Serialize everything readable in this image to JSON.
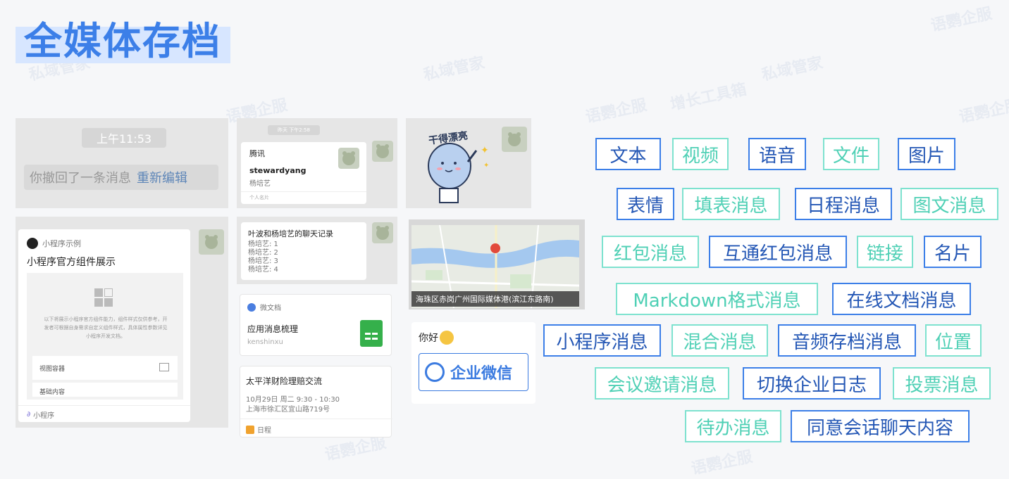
{
  "title": "全媒体存档",
  "watermarks": [
    "语鹦企服",
    "增长工具箱",
    "私域管家"
  ],
  "recall": {
    "time": "上午11:53",
    "text": "你撤回了一条消息",
    "link": "重新编辑"
  },
  "business_card": {
    "time": "昨天 下午2:58",
    "company": "腾讯",
    "name": "stewardyang",
    "sub": "杨培艺",
    "footer": "个人名片"
  },
  "sticker": {
    "caption": "干得漂亮"
  },
  "miniprogram": {
    "app": "小程序示例",
    "title": "小程序官方组件展示",
    "desc": "以下将展示小程序官方组件能力，组件样式仅供参考，开发者可根据自身需求自定义组件样式，具体属性参数详见小程序开发文档。",
    "menu1": "视图容器",
    "menu2": "基础内容",
    "footer": "小程序"
  },
  "chat_record": {
    "title": "叶波和杨培艺的聊天记录",
    "lines": [
      "杨培艺: 1",
      "杨培艺: 2",
      "杨培艺: 3",
      "杨培艺: 4"
    ]
  },
  "location": {
    "address": "海珠区赤岗广州国际媒体港(滨江东路南)"
  },
  "wedoc": {
    "app": "微文档",
    "title": "应用消息梳理",
    "owner": "kenshinxu"
  },
  "greeting": {
    "text": "你好",
    "logo_text": "企业微信"
  },
  "schedule": {
    "title": "太平洋财险理赔交流",
    "time": "10月29日 周二 9:30 - 10:30",
    "place": "上海市徐汇区宜山路719号",
    "footer": "日程"
  },
  "tags": [
    "文本",
    "视频",
    "语音",
    "文件",
    "图片",
    "表情",
    "填表消息",
    "日程消息",
    "图文消息",
    "红包消息",
    "互通红包消息",
    "链接",
    "名片",
    "Markdown格式消息",
    "在线文档消息",
    "小程序消息",
    "混合消息",
    "音频存档消息",
    "位置",
    "会议邀请消息",
    "切换企业日志",
    "投票消息",
    "待办消息",
    "同意会话聊天内容"
  ],
  "colors": {
    "title_blue": "#3c7fe8",
    "tag_blue": "#3c7fe8",
    "tag_teal": "#7ee2cf"
  }
}
